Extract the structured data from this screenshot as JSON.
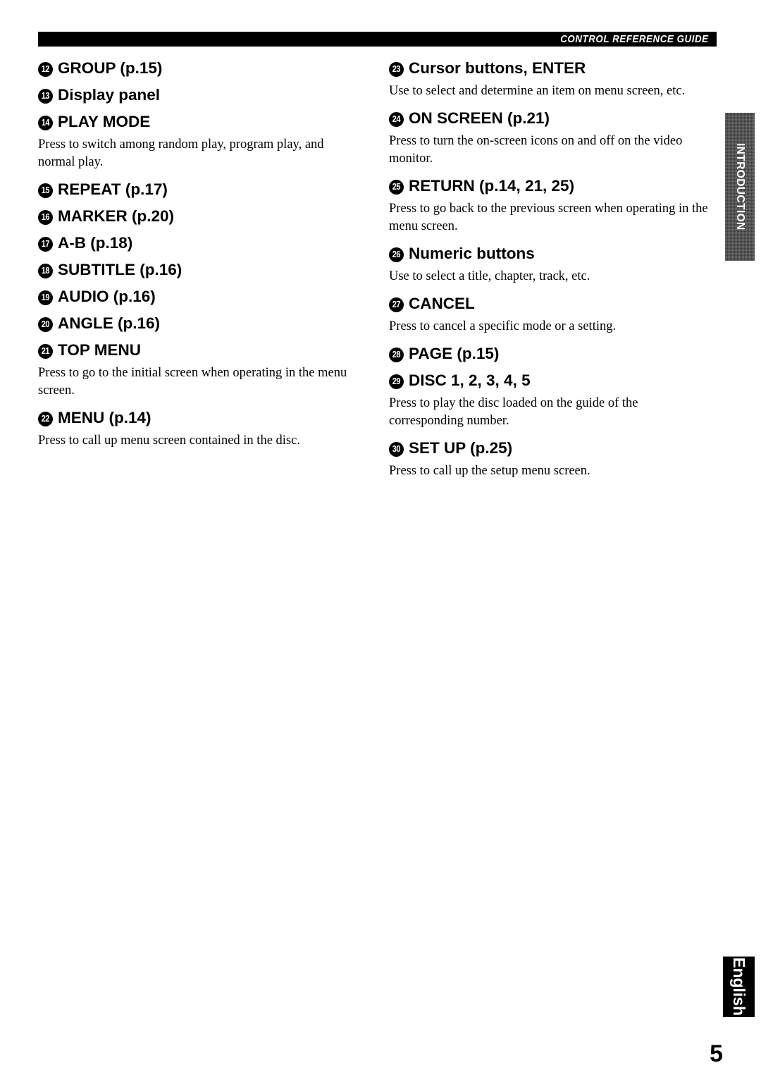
{
  "header": {
    "title": "CONTROL REFERENCE GUIDE"
  },
  "side_tabs": {
    "section": "INTRODUCTION",
    "language": "English"
  },
  "page_number": "5",
  "columns": {
    "left": [
      {
        "marker": "12",
        "label": "GROUP (p.15)",
        "body": ""
      },
      {
        "marker": "13",
        "label": "Display panel",
        "body": ""
      },
      {
        "marker": "14",
        "label": "PLAY MODE",
        "body": "Press to switch among random play, program play, and normal play."
      },
      {
        "marker": "15",
        "label": "REPEAT (p.17)",
        "body": ""
      },
      {
        "marker": "16",
        "label": "MARKER (p.20)",
        "body": ""
      },
      {
        "marker": "17",
        "label": "A-B (p.18)",
        "body": ""
      },
      {
        "marker": "18",
        "label": "SUBTITLE (p.16)",
        "body": ""
      },
      {
        "marker": "19",
        "label": "AUDIO (p.16)",
        "body": ""
      },
      {
        "marker": "20",
        "label": "ANGLE (p.16)",
        "body": ""
      },
      {
        "marker": "21",
        "label": "TOP MENU",
        "body": "Press to go to the initial screen when operating in the menu screen."
      },
      {
        "marker": "22",
        "label": "MENU (p.14)",
        "body": "Press to call up menu screen contained in the disc."
      }
    ],
    "right": [
      {
        "marker": "23",
        "label": "Cursor buttons, ENTER",
        "body": "Use to select and determine an item on menu screen, etc."
      },
      {
        "marker": "24",
        "label": "ON SCREEN (p.21)",
        "body": "Press to turn the on-screen icons on and off on the video monitor."
      },
      {
        "marker": "25",
        "label": "RETURN (p.14, 21, 25)",
        "body": "Press to go back to the previous screen when operating in the menu screen."
      },
      {
        "marker": "26",
        "label": "Numeric buttons",
        "body": "Use to select a title, chapter, track, etc."
      },
      {
        "marker": "27",
        "label": "CANCEL",
        "body": "Press to cancel a specific mode or a setting."
      },
      {
        "marker": "28",
        "label": "PAGE (p.15)",
        "body": ""
      },
      {
        "marker": "29",
        "label": "DISC 1, 2, 3, 4, 5",
        "body": "Press to play the disc loaded on the guide of the corresponding number."
      },
      {
        "marker": "30",
        "label": "SET UP (p.25)",
        "body": "Press to call up the setup menu screen."
      }
    ]
  }
}
